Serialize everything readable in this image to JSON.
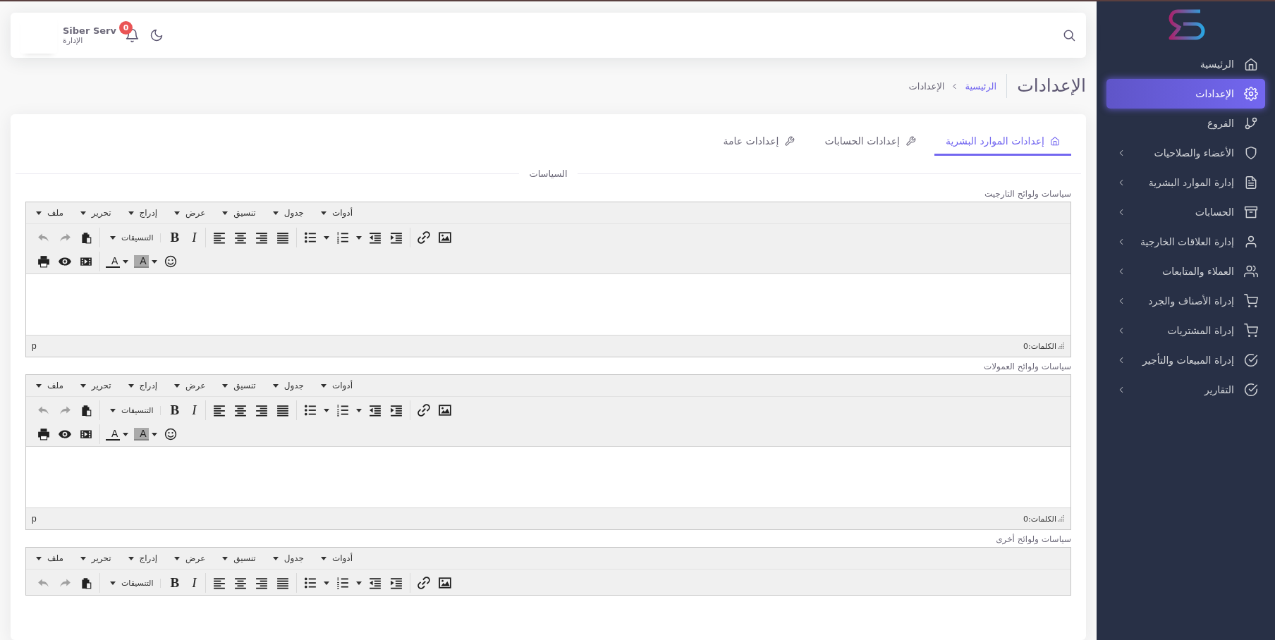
{
  "sidebar": {
    "items": [
      {
        "label": "الرئيسية",
        "kind": "home",
        "selected": false,
        "submenu": false
      },
      {
        "label": "الإعدادات",
        "kind": "gear",
        "selected": true,
        "submenu": false
      },
      {
        "label": "الفروع",
        "kind": "branch",
        "selected": false,
        "submenu": false
      },
      {
        "label": "الأعضاء والصلاحيات",
        "kind": "shield",
        "selected": false,
        "submenu": true
      },
      {
        "label": "إدارة الموارد البشرية",
        "kind": "document",
        "selected": false,
        "submenu": true
      },
      {
        "label": "الحسابات",
        "kind": "archive",
        "selected": false,
        "submenu": true
      },
      {
        "label": "إدارة العلاقات الخارجية",
        "kind": "user",
        "selected": false,
        "submenu": true
      },
      {
        "label": "العملاء والمتابعات",
        "kind": "users",
        "selected": false,
        "submenu": true
      },
      {
        "label": "إدراة الأصناف والجرد",
        "kind": "cart",
        "selected": false,
        "submenu": true
      },
      {
        "label": "إدراة المشتريات",
        "kind": "cart",
        "selected": false,
        "submenu": true
      },
      {
        "label": "إدراة المبيعات والتأجير",
        "kind": "check",
        "selected": false,
        "submenu": true
      },
      {
        "label": "التقارير",
        "kind": "check",
        "selected": false,
        "submenu": true
      }
    ]
  },
  "topbar": {
    "user_name": "Siber Serv",
    "user_role": "الإدارة",
    "notification_count": "0"
  },
  "page_title": "الإعدادات",
  "breadcrumb": [
    {
      "label": "الرئيسية",
      "link": true
    },
    {
      "label": "الإعدادات",
      "link": false
    }
  ],
  "tabs": [
    {
      "label": "إعدادات الموارد البشرية",
      "kind": "home",
      "selected": true
    },
    {
      "label": "إعدادات الحسابات",
      "kind": "wrench",
      "selected": false
    },
    {
      "label": "إعدادات عامة",
      "kind": "wrench",
      "selected": false
    }
  ],
  "section_title": "السياسات",
  "editors": [
    {
      "label": "سياسات ولوائح التارجيت",
      "menus": [
        "أدوات",
        "جدول",
        "تنسيق",
        "عرض",
        "إدراج",
        "تحرير",
        "ملف"
      ],
      "toolbar": {
        "undo_disabled": true,
        "redo_disabled": true,
        "formats": "التنسيقات",
        "bold": "B",
        "italic": "I",
        "text_color": "A",
        "highlight": "A"
      },
      "path": "p",
      "word_count": "الكلمات:0"
    },
    {
      "label": "سياسات ولوائح العمولات",
      "menus": [
        "أدوات",
        "جدول",
        "تنسيق",
        "عرض",
        "إدراج",
        "تحرير",
        "ملف"
      ],
      "toolbar": {
        "undo_disabled": true,
        "redo_disabled": true,
        "formats": "التنسيقات",
        "bold": "B",
        "italic": "I",
        "text_color": "A",
        "highlight": "A"
      },
      "path": "p",
      "word_count": "الكلمات:0"
    },
    {
      "label": "سياسات ولوائح أخرى",
      "menus": [
        "أدوات",
        "جدول",
        "تنسيق",
        "عرض",
        "إدراج",
        "تحرير",
        "ملف"
      ],
      "toolbar": {
        "undo_disabled": true,
        "redo_disabled": true,
        "formats": "التنسيقات",
        "bold": "B",
        "italic": "I"
      }
    }
  ]
}
